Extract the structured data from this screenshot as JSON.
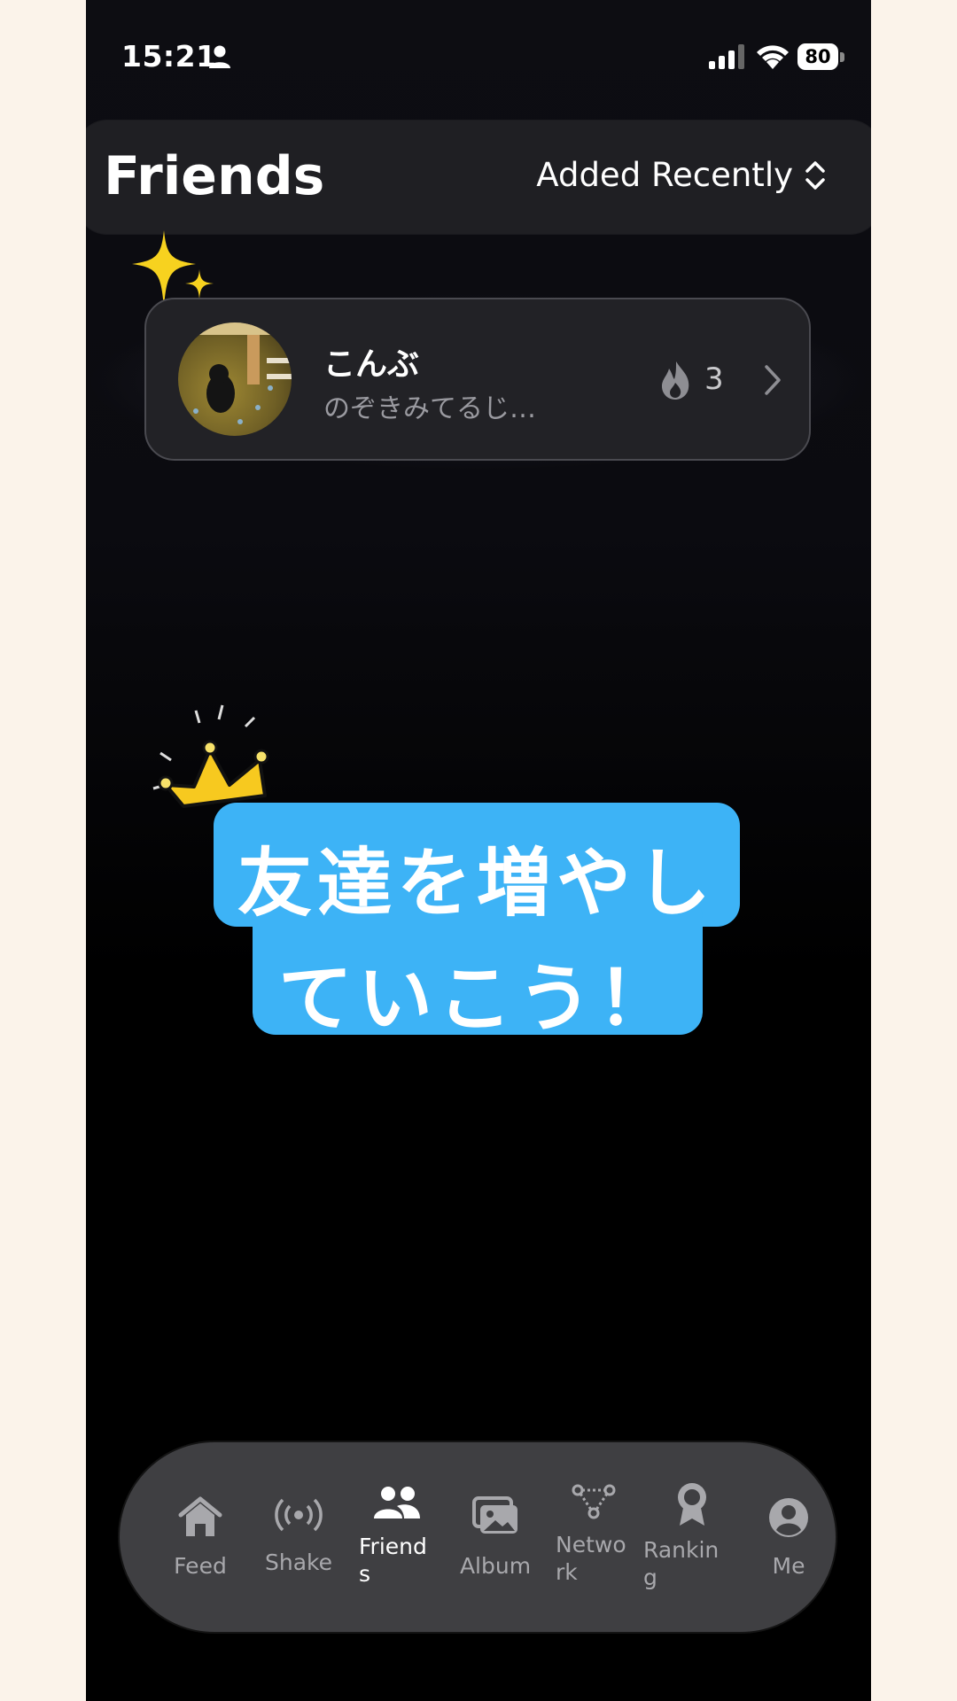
{
  "status": {
    "time": "15:21",
    "battery": "80"
  },
  "header": {
    "title": "Friends",
    "sort_label": "Added Recently"
  },
  "friend": {
    "name": "こんぶ",
    "message": "のぞきみてるじ…",
    "streak": "3"
  },
  "banner": {
    "line1": "友達を増やし",
    "line2": "ていこう！"
  },
  "tabs": [
    {
      "label": "Feed",
      "icon": "house-icon"
    },
    {
      "label": "Shake",
      "icon": "broadcast-icon"
    },
    {
      "label": "Friend\ns",
      "icon": "people-icon"
    },
    {
      "label": "Album",
      "icon": "photos-icon"
    },
    {
      "label": "Netwo\nrk",
      "icon": "network-icon"
    },
    {
      "label": "Rankin\ng",
      "icon": "ribbon-icon"
    },
    {
      "label": "Me",
      "icon": "person-circle-icon"
    }
  ],
  "active_tab": "Friend\ns",
  "colors": {
    "banner": "#3db3f6",
    "sparkle": "#f7d21f",
    "crown": "#f7c91f"
  }
}
